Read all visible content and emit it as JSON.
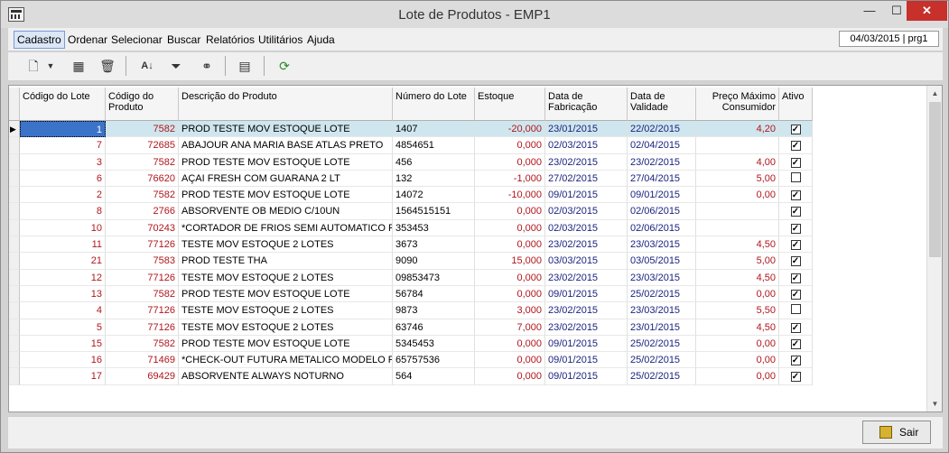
{
  "window": {
    "title": "Lote de Produtos - EMP1",
    "minimize": "—",
    "maximize": "☐",
    "close": "✕"
  },
  "menu": {
    "items": [
      "Cadastro",
      "Ordenar",
      "Selecionar",
      "Buscar",
      "Relatórios",
      "Utilitários",
      "Ajuda"
    ],
    "status": "04/03/2015 | prg1"
  },
  "toolbar": {
    "icons": [
      "new-document-icon",
      "dropdown-arrow-icon",
      "edit-icon",
      "delete-icon",
      "sort-az-icon",
      "filter-icon",
      "binoculars-icon",
      "columns-icon",
      "refresh-icon"
    ]
  },
  "grid": {
    "columns": [
      "Código do Lote",
      "Código do Produto",
      "Descrição do Produto",
      "Número do Lote",
      "Estoque",
      "Data de Fabricação",
      "Data de Validade",
      "Preço Máximo Consumidor",
      "Ativo"
    ],
    "rows": [
      {
        "lote": "1",
        "produto": "7582",
        "descricao": "PROD TESTE MOV ESTOQUE LOTE",
        "numero": "1407",
        "estoque": "-20,000",
        "fab": "23/01/2015",
        "val": "22/02/2015",
        "preco": "4,20",
        "ativo": true
      },
      {
        "lote": "7",
        "produto": "72685",
        "descricao": "ABAJOUR ANA MARIA BASE ATLAS PRETO",
        "numero": "4854651",
        "estoque": "0,000",
        "fab": "02/03/2015",
        "val": "02/04/2015",
        "preco": "",
        "ativo": true
      },
      {
        "lote": "3",
        "produto": "7582",
        "descricao": "PROD TESTE MOV ESTOQUE LOTE",
        "numero": "456",
        "estoque": "0,000",
        "fab": "23/02/2015",
        "val": "23/02/2015",
        "preco": "4,00",
        "ativo": true
      },
      {
        "lote": "6",
        "produto": "76620",
        "descricao": "AÇAI FRESH COM GUARANA 2 LT",
        "numero": "132",
        "estoque": "-1,000",
        "fab": "27/02/2015",
        "val": "27/04/2015",
        "preco": "5,00",
        "ativo": false
      },
      {
        "lote": "2",
        "produto": "7582",
        "descricao": "PROD TESTE MOV ESTOQUE LOTE",
        "numero": "14072",
        "estoque": "-10,000",
        "fab": "09/01/2015",
        "val": "09/01/2015",
        "preco": "0,00",
        "ativo": true
      },
      {
        "lote": "8",
        "produto": "2766",
        "descricao": "ABSORVENTE OB MEDIO C/10UN",
        "numero": "1564515151",
        "estoque": "0,000",
        "fab": "02/03/2015",
        "val": "02/06/2015",
        "preco": "",
        "ativo": true
      },
      {
        "lote": "10",
        "produto": "70243",
        "descricao": "*CORTADOR DE FRIOS SEMI AUTOMATICO FI",
        "numero": "353453",
        "estoque": "0,000",
        "fab": "02/03/2015",
        "val": "02/06/2015",
        "preco": "",
        "ativo": true
      },
      {
        "lote": "11",
        "produto": "77126",
        "descricao": "TESTE MOV ESTOQUE 2 LOTES",
        "numero": "3673",
        "estoque": "0,000",
        "fab": "23/02/2015",
        "val": "23/03/2015",
        "preco": "4,50",
        "ativo": true
      },
      {
        "lote": "21",
        "produto": "7583",
        "descricao": "PROD TESTE THA",
        "numero": "9090",
        "estoque": "15,000",
        "fab": "03/03/2015",
        "val": "03/05/2015",
        "preco": "5,00",
        "ativo": true
      },
      {
        "lote": "12",
        "produto": "77126",
        "descricao": "TESTE MOV ESTOQUE 2 LOTES",
        "numero": "09853473",
        "estoque": "0,000",
        "fab": "23/02/2015",
        "val": "23/03/2015",
        "preco": "4,50",
        "ativo": true
      },
      {
        "lote": "13",
        "produto": "7582",
        "descricao": "PROD TESTE MOV ESTOQUE LOTE",
        "numero": "56784",
        "estoque": "0,000",
        "fab": "09/01/2015",
        "val": "25/02/2015",
        "preco": "0,00",
        "ativo": true
      },
      {
        "lote": "4",
        "produto": "77126",
        "descricao": "TESTE MOV ESTOQUE 2 LOTES",
        "numero": "9873",
        "estoque": "3,000",
        "fab": "23/02/2015",
        "val": "23/03/2015",
        "preco": "5,50",
        "ativo": false
      },
      {
        "lote": "5",
        "produto": "77126",
        "descricao": "TESTE MOV ESTOQUE 2 LOTES",
        "numero": "63746",
        "estoque": "7,000",
        "fab": "23/02/2015",
        "val": "23/01/2015",
        "preco": "4,50",
        "ativo": true
      },
      {
        "lote": "15",
        "produto": "7582",
        "descricao": "PROD TESTE MOV ESTOQUE LOTE",
        "numero": "5345453",
        "estoque": "0,000",
        "fab": "09/01/2015",
        "val": "25/02/2015",
        "preco": "0,00",
        "ativo": true
      },
      {
        "lote": "16",
        "produto": "71469",
        "descricao": "*CHECK-OUT FUTURA METALICO MODELO FG",
        "numero": "65757536",
        "estoque": "0,000",
        "fab": "09/01/2015",
        "val": "25/02/2015",
        "preco": "0,00",
        "ativo": true
      },
      {
        "lote": "17",
        "produto": "69429",
        "descricao": "ABSORVENTE ALWAYS NOTURNO",
        "numero": "564",
        "estoque": "0,000",
        "fab": "09/01/2015",
        "val": "25/02/2015",
        "preco": "0,00",
        "ativo": true
      }
    ]
  },
  "footer": {
    "exit_label": "Sair"
  }
}
